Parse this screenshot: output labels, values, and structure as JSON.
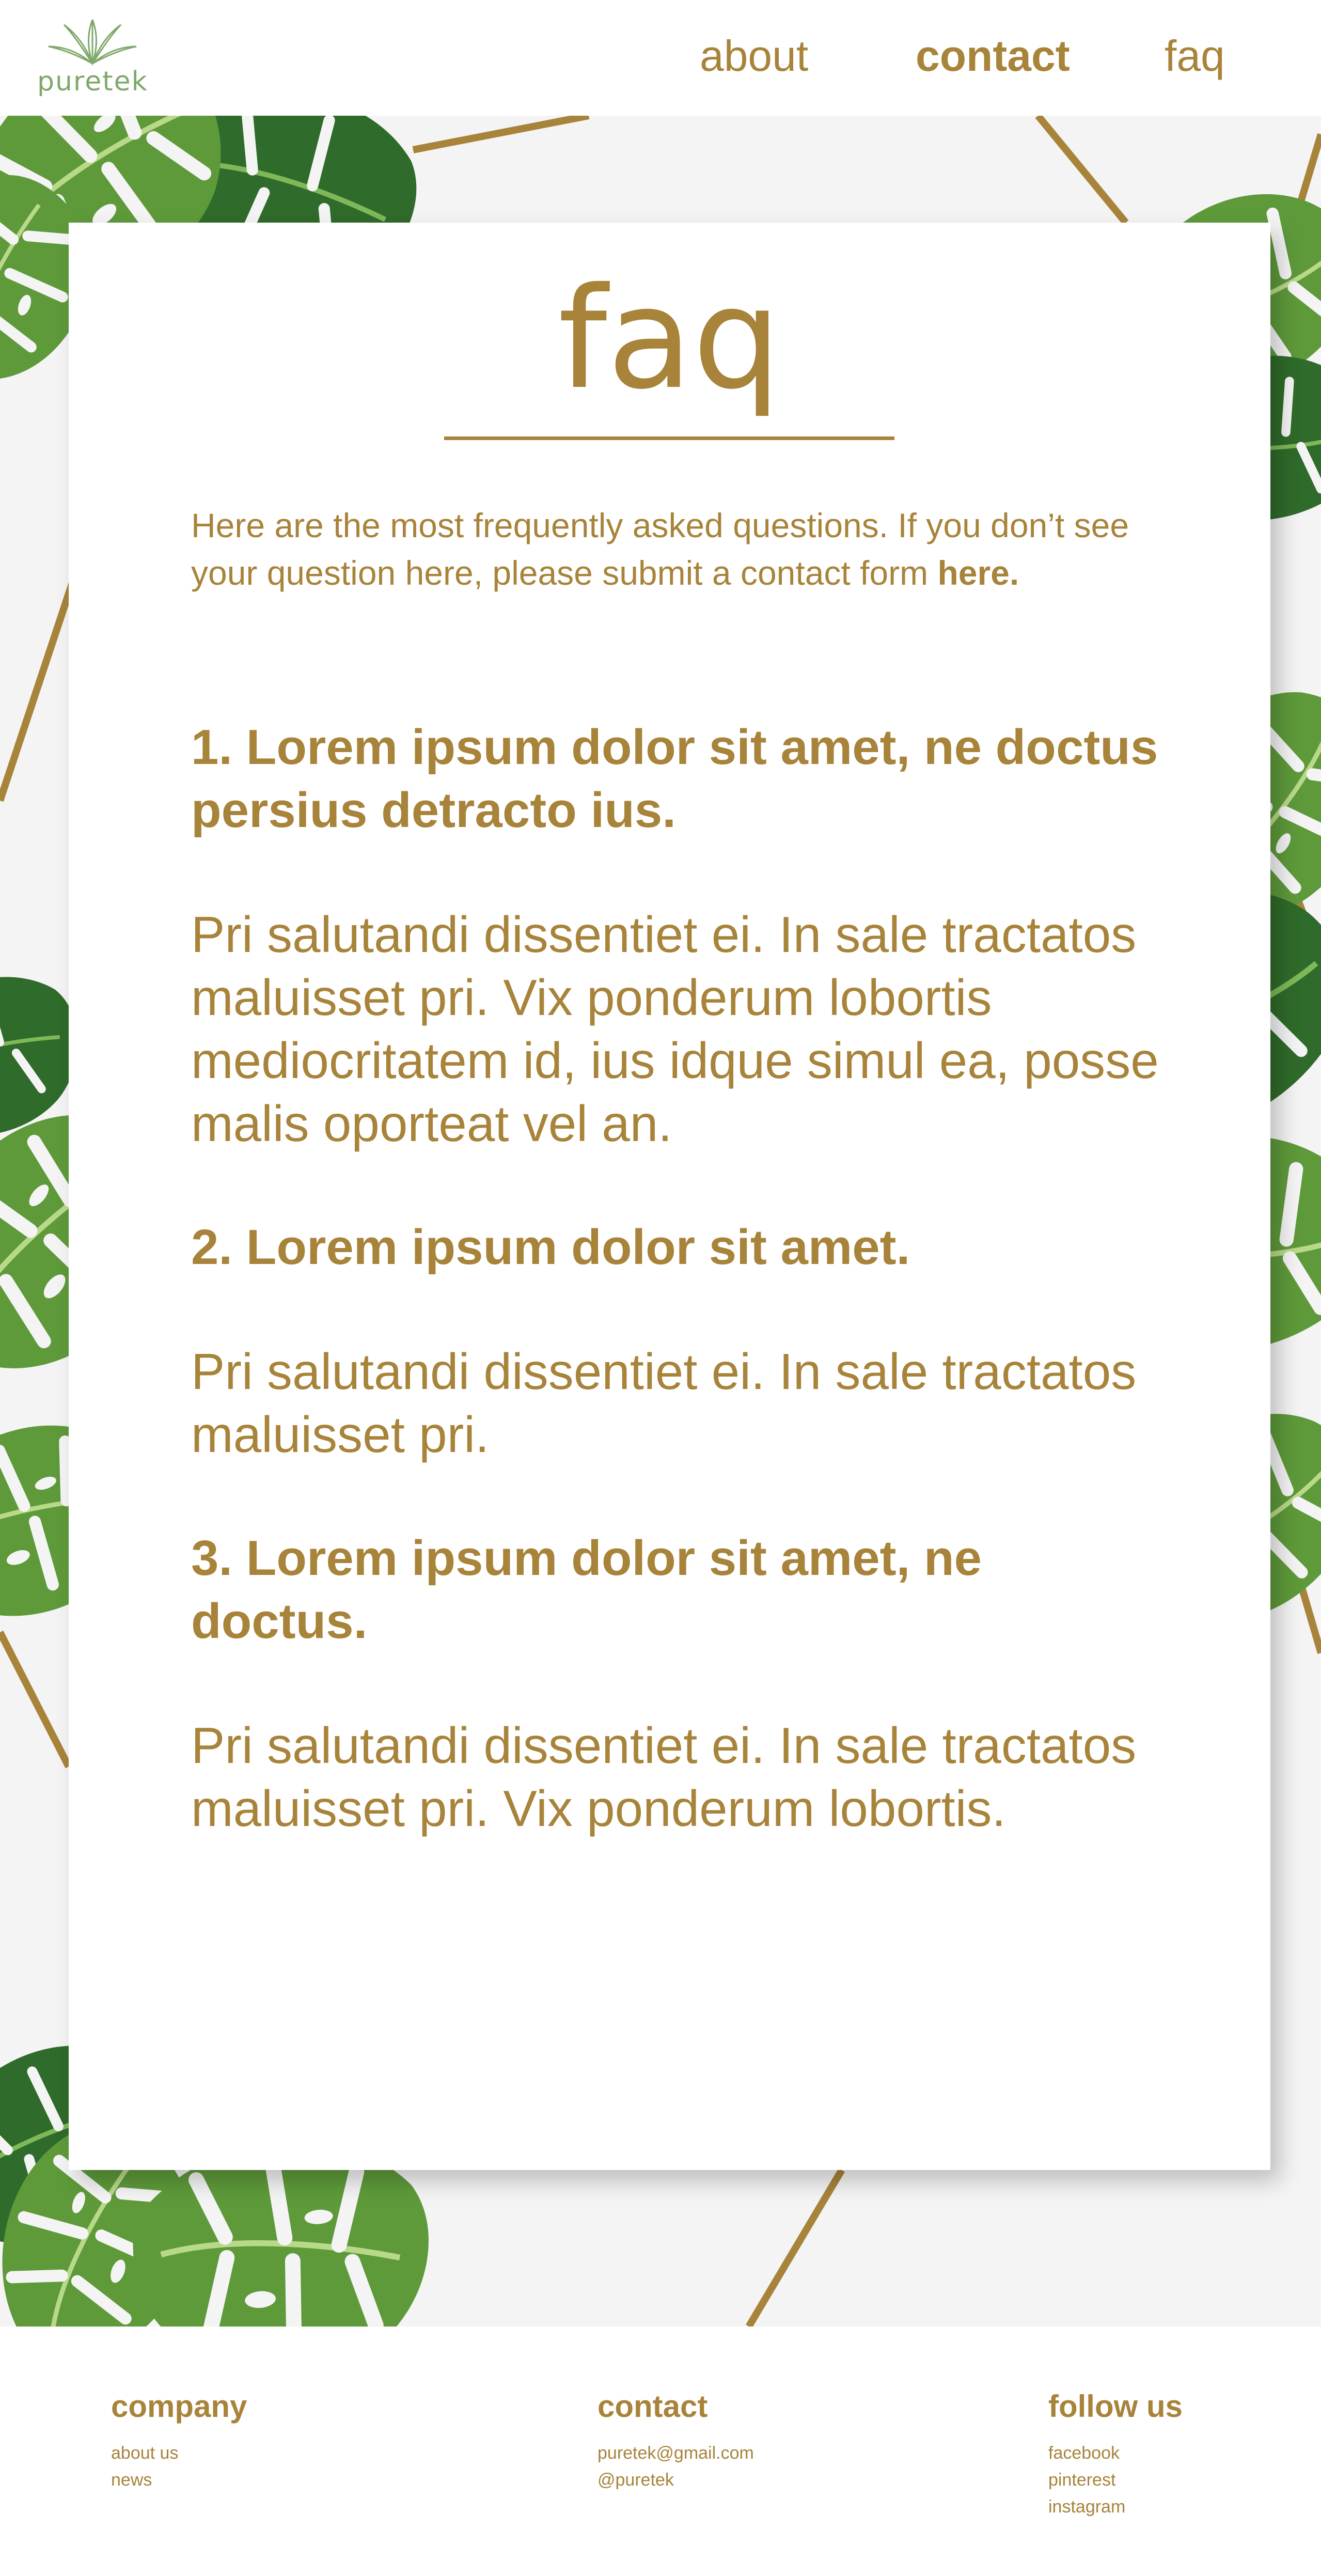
{
  "brand": {
    "name": "puretek"
  },
  "nav": {
    "about": "about",
    "contact": "contact",
    "faq": "faq"
  },
  "page": {
    "title": "faq",
    "intro_text": "Here are the most frequently asked questions. If you don’t see your question here, please submit a contact form ",
    "intro_link": "here."
  },
  "faqs": [
    {
      "question": "1. Lorem ipsum dolor sit amet, ne doctus persius detracto ius.",
      "answer": "Pri salutandi dissentiet ei. In sale tractatos maluisset pri. Vix ponderum lobortis mediocritatem id, ius idque simul ea, posse malis oporteat vel an."
    },
    {
      "question": "2. Lorem ipsum dolor sit amet.",
      "answer": "Pri salutandi dissentiet ei. In sale tractatos maluisset pri."
    },
    {
      "question": "3. Lorem ipsum dolor sit amet, ne doctus.",
      "answer": "Pri salutandi dissentiet ei. In sale tractatos maluisset pri. Vix ponderum lobortis."
    }
  ],
  "footer": {
    "company": {
      "heading": "company",
      "links": [
        "about us",
        "news"
      ]
    },
    "contact": {
      "heading": "contact",
      "links": [
        "puretek@gmail.com",
        "@puretek"
      ]
    },
    "follow": {
      "heading": "follow us",
      "links": [
        "facebook",
        "pinterest",
        "instagram"
      ]
    }
  },
  "colors": {
    "accent": "#a8833a",
    "leaf": "#5e9a3a",
    "leaf_dark": "#2f6b2a",
    "background": "#f4f4f4"
  },
  "icons": {
    "logo": "cannabis-leaf-logo"
  }
}
